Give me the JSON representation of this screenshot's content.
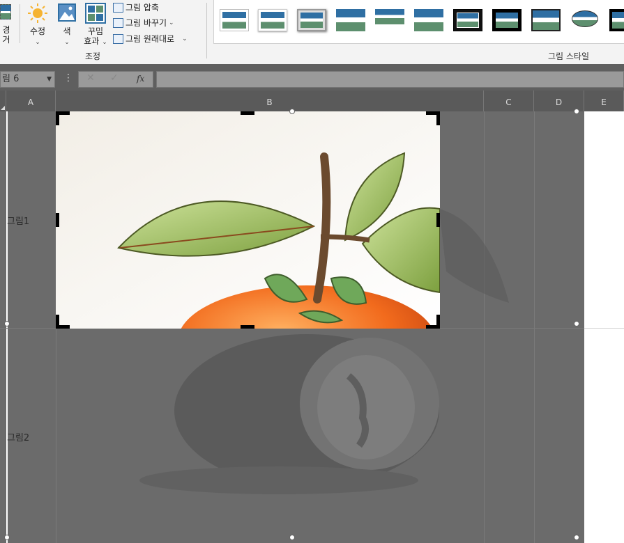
{
  "ribbon": {
    "remove_bg_label_top": "경",
    "remove_bg_label_bottom": "거",
    "corrections_label": "수정",
    "color_label": "색",
    "artistic_label_top": "꾸밈",
    "artistic_label_bottom": "효과",
    "compress_label": "그림 압축",
    "change_label": "그림 바꾸기",
    "reset_label": "그림 원래대로",
    "adjust_group_label": "조정",
    "styles_group_label": "그림 스타일"
  },
  "formula_bar": {
    "name_box": "림 6",
    "more_symbol": "⋮",
    "cancel_symbol": "✕",
    "enter_symbol": "✓",
    "fx_symbol": "fx",
    "formula_value": ""
  },
  "columns": [
    "A",
    "B",
    "C",
    "D",
    "E"
  ],
  "cells": {
    "a1": "그림1",
    "a2": "그림2"
  },
  "colors": {
    "ribbon_bg": "#f3f3f3",
    "sheet_dim": "#6b6b6b",
    "accent": "#2f6fa3",
    "persimmon": "#f26b1d",
    "leaf": "#8fb24f"
  }
}
